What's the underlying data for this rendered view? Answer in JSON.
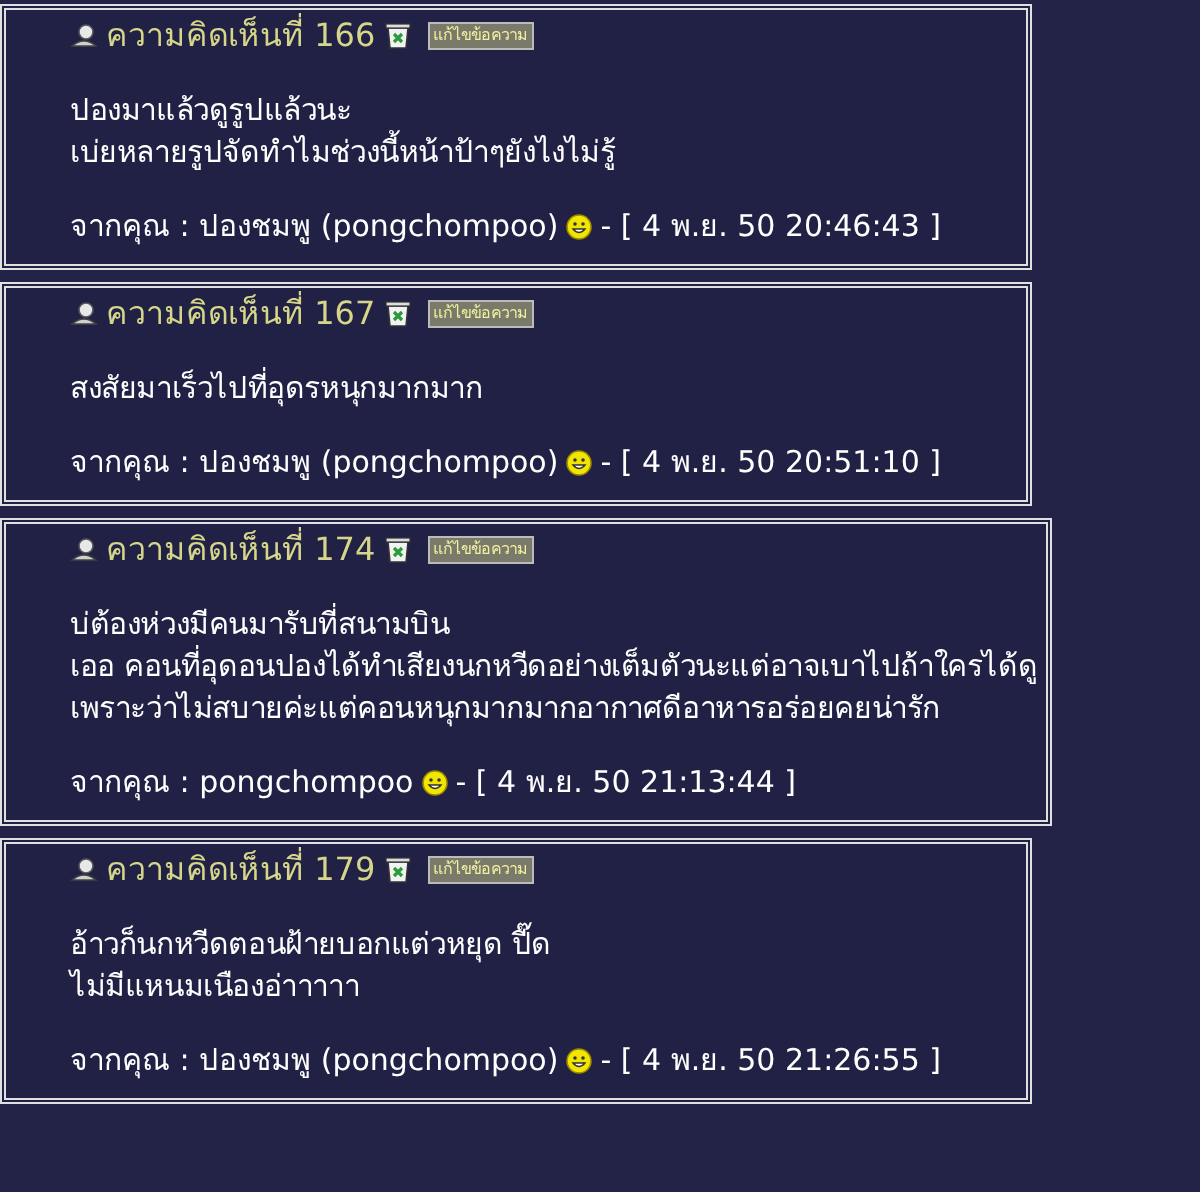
{
  "comments": [
    {
      "title": "ความคิดเห็นที่ 166",
      "edit_label": "แก้ไขข้อความ",
      "lines": [
        "ปองมาแล้วดูรูปแล้วนะ",
        "เบ่ยหลายรูปจัดทำไมช่วงนี้หน้าป้าๆยังไงไม่รู้"
      ],
      "author": "จากคุณ : ปองชมพู (pongchompoo)",
      "date": "- [ 4 พ.ย. 50 20:46:43 ]"
    },
    {
      "title": "ความคิดเห็นที่ 167",
      "edit_label": "แก้ไขข้อความ",
      "lines": [
        "สงสัยมาเร็วไปที่อุดรหนุกมากมาก"
      ],
      "author": "จากคุณ : ปองชมพู (pongchompoo)",
      "date": "- [ 4 พ.ย. 50 20:51:10 ]"
    },
    {
      "title": "ความคิดเห็นที่ 174",
      "edit_label": "แก้ไขข้อความ",
      "lines": [
        "บ่ต้องห่วงมีคนมารับที่สนามบิน",
        "เออ คอนที่อุดอนปองได้ทำเสียงนกหวีดอย่างเต็มตัวนะแต่อาจเบาไปถ้าใครได้ดู",
        "เพราะว่าไม่สบายค่ะแต่คอนหนุกมากมากอากาศดีอาหารอร่อยคยน่ารัก"
      ],
      "author": "จากคุณ : pongchompoo",
      "date": "- [ 4 พ.ย. 50 21:13:44 ]"
    },
    {
      "title": "ความคิดเห็นที่ 179",
      "edit_label": "แก้ไขข้อความ",
      "lines": [
        "อ้าวก็นกหวีดตอนฝ้ายบอกแต่วหยุด ปี๊ด",
        "ไม่มีแหนมเนืองอ่าาาาา"
      ],
      "author": "จากคุณ : ปองชมพู (pongchompoo)",
      "date": "- [ 4 พ.ย. 50 21:26:55 ]"
    }
  ]
}
